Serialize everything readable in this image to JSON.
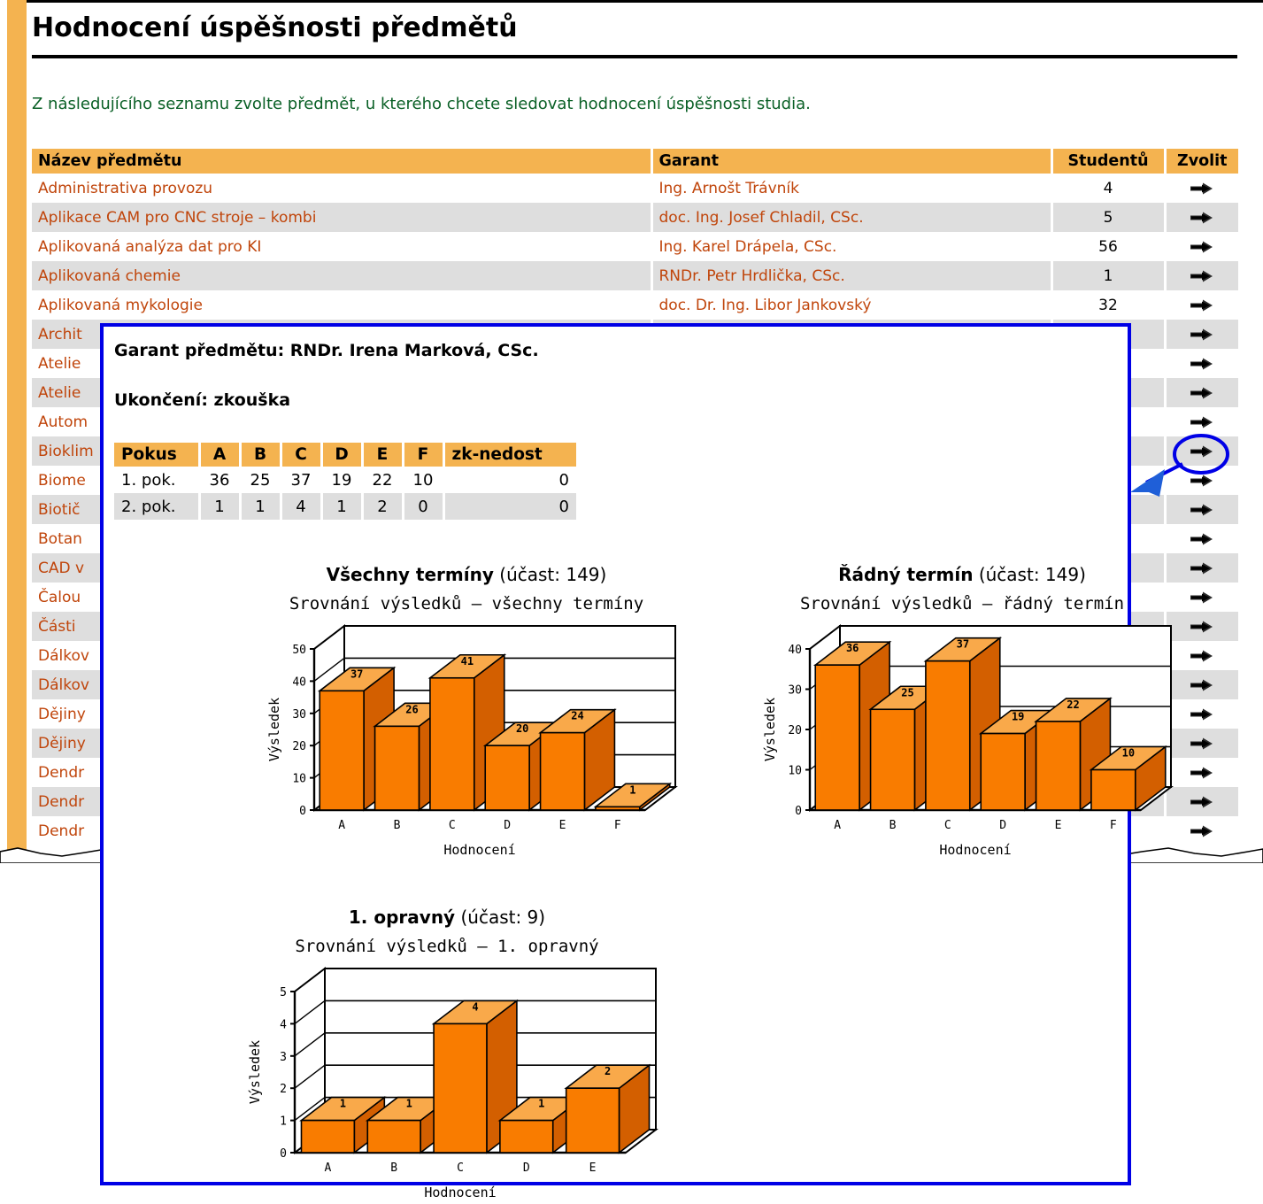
{
  "header": {
    "title": "Hodnocení úspěšnosti předmětů",
    "intro": "Z následujícího seznamu zvolte předmět, u kterého chcete sledovat hodnocení úspěšnosti studia."
  },
  "subject_table": {
    "columns": [
      "Název předmětu",
      "Garant",
      "Studentů",
      "Zvolit"
    ],
    "action_icon": "arrow-right-icon",
    "rows": [
      {
        "name": "Administrativa provozu",
        "garant": "Ing. Arnošt Trávník",
        "students": "4"
      },
      {
        "name": "Aplikace CAM pro CNC stroje – kombi",
        "garant": "doc. Ing. Josef Chladil, CSc.",
        "students": "5"
      },
      {
        "name": "Aplikovaná analýza dat pro KI",
        "garant": "Ing. Karel Drápela, CSc.",
        "students": "56"
      },
      {
        "name": "Aplikovaná chemie",
        "garant": "RNDr. Petr Hrdlička, CSc.",
        "students": "1"
      },
      {
        "name": "Aplikovaná mykologie",
        "garant": "doc. Dr. Ing. Libor Jankovský",
        "students": "32"
      },
      {
        "name": "Archit",
        "garant": "",
        "students": ""
      },
      {
        "name": "Atelie",
        "garant": "",
        "students": ""
      },
      {
        "name": "Atelie",
        "garant": "",
        "students": ""
      },
      {
        "name": "Autom",
        "garant": "",
        "students": ""
      },
      {
        "name": "Bioklim",
        "garant": "",
        "students": ""
      },
      {
        "name": "Biome",
        "garant": "",
        "students": ""
      },
      {
        "name": "Biotič",
        "garant": "",
        "students": ""
      },
      {
        "name": "Botan",
        "garant": "",
        "students": ""
      },
      {
        "name": "CAD v",
        "garant": "",
        "students": ""
      },
      {
        "name": "Čalou",
        "garant": "",
        "students": ""
      },
      {
        "name": "Části",
        "garant": "",
        "students": ""
      },
      {
        "name": "Dálkov",
        "garant": "",
        "students": ""
      },
      {
        "name": "Dálkov",
        "garant": "",
        "students": ""
      },
      {
        "name": "Dějiny",
        "garant": "",
        "students": ""
      },
      {
        "name": "Dějiny",
        "garant": "",
        "students": ""
      },
      {
        "name": "Dendr",
        "garant": "",
        "students": ""
      },
      {
        "name": "Dendr",
        "garant": "",
        "students": ""
      },
      {
        "name": "Dendr",
        "garant": "",
        "students": ""
      }
    ]
  },
  "popup": {
    "garant_line": "Garant předmětu: RNDr. Irena Marková, CSc.",
    "ukonceni_line": "Ukončení: zkouška",
    "attempts_table": {
      "columns": [
        "Pokus",
        "A",
        "B",
        "C",
        "D",
        "E",
        "F",
        "zk-nedost"
      ],
      "rows": [
        {
          "pokus": "1. pok.",
          "a": "36",
          "b": "25",
          "c": "37",
          "d": "19",
          "e": "22",
          "f": "10",
          "zk": "0"
        },
        {
          "pokus": "2. pok.",
          "a": "1",
          "b": "1",
          "c": "4",
          "d": "1",
          "e": "2",
          "f": "0",
          "zk": "0"
        }
      ]
    }
  },
  "chart_data": [
    {
      "id": "all",
      "type": "bar",
      "heading_bold": "Všechny termíny",
      "heading_rest": "(účast: 149)",
      "title": "Srovnání výsledků – všechny termíny",
      "xlabel": "Hodnocení",
      "ylabel": "Výsledek",
      "categories": [
        "A",
        "B",
        "C",
        "D",
        "E",
        "F"
      ],
      "values": [
        37,
        26,
        41,
        20,
        24,
        1
      ],
      "yticks": [
        0,
        10,
        20,
        30,
        40,
        50
      ],
      "ylim": [
        0,
        50
      ],
      "grid": true,
      "bar_color": "#f97c00",
      "bar_top_color": "#f9a94a",
      "bar_side_color": "#d35f00"
    },
    {
      "id": "radny",
      "type": "bar",
      "heading_bold": "Řádný termín",
      "heading_rest": "(účast: 149)",
      "title": "Srovnání výsledků – řádný termín",
      "xlabel": "Hodnocení",
      "ylabel": "Výsledek",
      "categories": [
        "A",
        "B",
        "C",
        "D",
        "E",
        "F"
      ],
      "values": [
        36,
        25,
        37,
        19,
        22,
        10
      ],
      "yticks": [
        0,
        10,
        20,
        30,
        40
      ],
      "ylim": [
        0,
        40
      ],
      "grid": true,
      "bar_color": "#f97c00",
      "bar_top_color": "#f9a94a",
      "bar_side_color": "#d35f00"
    },
    {
      "id": "opravny",
      "type": "bar",
      "heading_bold": "1. opravný",
      "heading_rest": "(účast: 9)",
      "title": "Srovnání výsledků – 1. opravný",
      "xlabel": "Hodnocení",
      "ylabel": "Výsledek",
      "categories": [
        "A",
        "B",
        "C",
        "D",
        "E"
      ],
      "values": [
        1,
        1,
        4,
        1,
        2
      ],
      "yticks": [
        0,
        1,
        2,
        3,
        4,
        5
      ],
      "ylim": [
        0,
        5
      ],
      "grid": true,
      "bar_color": "#f97c00",
      "bar_top_color": "#f9a94a",
      "bar_side_color": "#d35f00"
    }
  ],
  "annotation": {
    "highlight_shape": "ellipse-highlight",
    "pointer_shape": "arrow-pointer",
    "color": "#0000e6"
  },
  "colors": {
    "accent_orange": "#f4b350",
    "link_rust": "#c0450b",
    "intro_green": "#0a6026",
    "row_alt": "#dedede",
    "popup_border": "#0000e6"
  }
}
